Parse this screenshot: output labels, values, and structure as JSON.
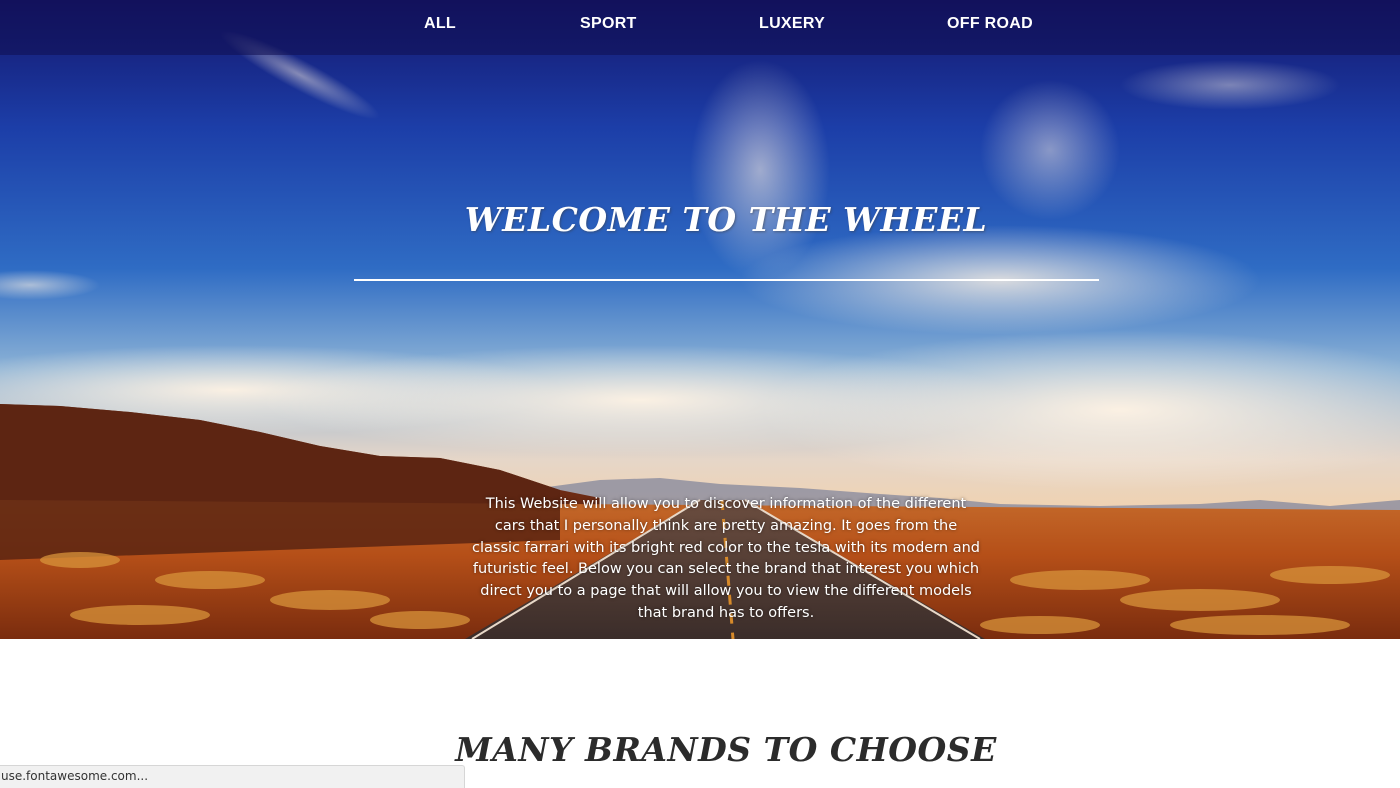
{
  "nav": {
    "items": [
      {
        "label": "ALL"
      },
      {
        "label": "SPORT"
      },
      {
        "label": "LUXERY"
      },
      {
        "label": "OFF ROAD"
      }
    ]
  },
  "hero": {
    "title": "WELCOME TO THE WHEEL",
    "description": "This Website will allow you to discover information of the different cars that I personally think are pretty amazing. It goes from the classic farrari with its bright red color to the tesla with its modern and futuristic feel. Below you can select the brand that interest you which direct you to a page that will allow you to view the different models that brand has to offers."
  },
  "brands_section": {
    "title": "MANY BRANDS TO CHOOSE"
  },
  "status_bar": {
    "text": "use.fontawesome.com..."
  },
  "colors": {
    "nav_background": "#100e50",
    "nav_text": "#ffffff",
    "hero_text": "#ffffff",
    "section_title": "#2b2b2b",
    "page_background": "#ffffff",
    "status_bar_background": "#f1f1f1"
  }
}
